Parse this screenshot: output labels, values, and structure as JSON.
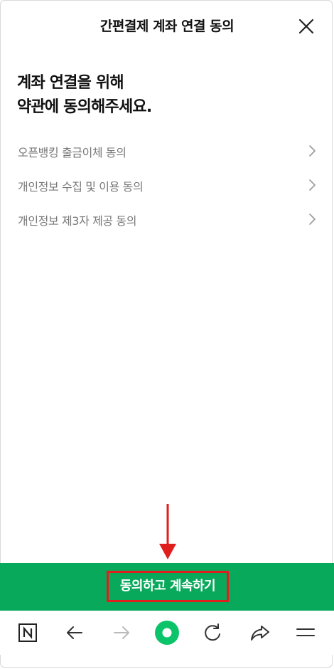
{
  "header": {
    "title": "간편결제 계좌 연결 동의"
  },
  "main": {
    "heading_line1": "계좌 연결을 위해",
    "heading_line2": "약관에 동의해주세요."
  },
  "terms": [
    {
      "label": "오픈뱅킹 출금이체 동의"
    },
    {
      "label": "개인정보 수집 및 이용 동의"
    },
    {
      "label": "개인정보 제3자 제공 동의"
    }
  ],
  "cta": {
    "label": "동의하고 계속하기"
  },
  "colors": {
    "brand_green": "#09a95b",
    "annotation_red": "#e01e1e",
    "text_gray": "#777777"
  },
  "bottom_nav": {
    "icons": [
      "naver-home-icon",
      "back-arrow-icon",
      "forward-arrow-icon",
      "green-dot-icon",
      "refresh-icon",
      "share-icon",
      "menu-icon"
    ]
  }
}
